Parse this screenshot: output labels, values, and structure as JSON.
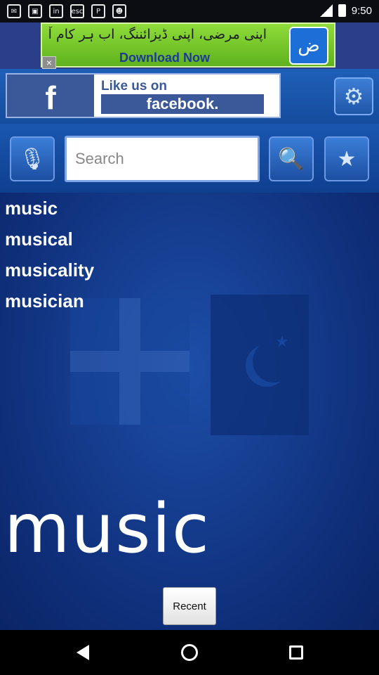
{
  "status_bar": {
    "time": "9:50",
    "icons": [
      "notification-icon",
      "image-icon",
      "linkedin-icon",
      "esc-icon",
      "pinterest-icon",
      "robot-icon"
    ]
  },
  "ad": {
    "urdu_text": "اپنی مرضی، اپنی ڈیزائننگ، اب ہر کام آپ کے ہاتھ",
    "download_label": "Download Now",
    "logo_letter": "ض",
    "close_label": "×"
  },
  "facebook": {
    "f_letter": "f",
    "like_text": "Like us on",
    "brand_text": "facebook."
  },
  "search": {
    "placeholder": "Search",
    "value": ""
  },
  "suggestions": [
    "music",
    "musical",
    "musicality",
    "musician"
  ],
  "current_word": "music",
  "recent_label": "Recent",
  "colors": {
    "header_blue": "#1a57b0",
    "main_blue": "#0f2f7a",
    "ad_green": "#6cc02a",
    "fb_blue": "#3b5998"
  }
}
